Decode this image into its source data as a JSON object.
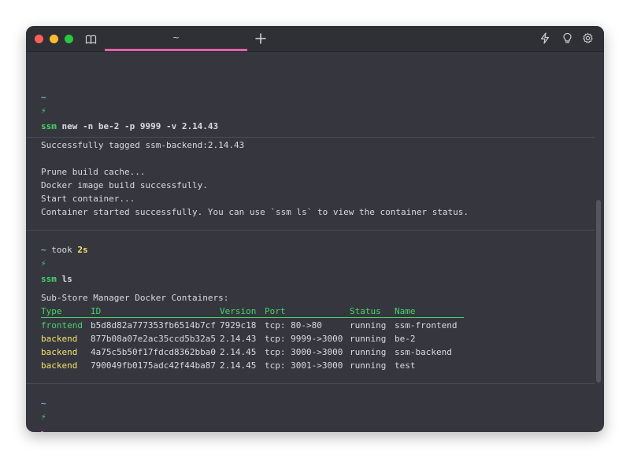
{
  "tab": {
    "title": "~"
  },
  "blocks": [
    {
      "dir": "~",
      "took_label": "",
      "took_value": "",
      "prompt_symbol": "⚡",
      "command": "ssm",
      "args": "new -n be-2 -p 9999 -v 2.14.43",
      "output": [
        "Successfully tagged ssm-backend:2.14.43",
        "",
        "Prune build cache...",
        "Docker image build successfully.",
        "Start container...",
        "Container started successfully. You can use `ssm ls` to view the container status."
      ]
    },
    {
      "dir": "~",
      "took_label": "took",
      "took_value": "2s",
      "prompt_symbol": "⚡",
      "command": "ssm",
      "args": "ls",
      "output_title": "Sub-Store Manager Docker Containers:",
      "table": {
        "headers": [
          "Type",
          "ID",
          "Version",
          "Port",
          "Status",
          "Name"
        ],
        "rows": [
          [
            "frontend",
            "b5d8d82a777353fb6514b7cf",
            "7929c18",
            "tcp: 80->80",
            "running",
            "ssm-frontend"
          ],
          [
            "backend",
            "877b08a07e2ac35ccd5b32a5",
            "2.14.43",
            "tcp: 9999->3000",
            "running",
            "be-2"
          ],
          [
            "backend",
            "4a75c5b50f17fdcd8362bba0",
            "2.14.45",
            "tcp: 3000->3000",
            "running",
            "ssm-backend"
          ],
          [
            "backend",
            "790049fb0175adc42f44ba87",
            "2.14.45",
            "tcp: 3001->3000",
            "running",
            "test"
          ]
        ]
      }
    },
    {
      "dir": "~",
      "prompt_symbol": "⚡"
    }
  ],
  "colors": {
    "accent": "#e062a8",
    "prompt_green": "#45d36b",
    "frontend_green": "#45d36b",
    "backend_yellow": "#f1e36e",
    "dir_cyan": "#8fdcf0"
  }
}
